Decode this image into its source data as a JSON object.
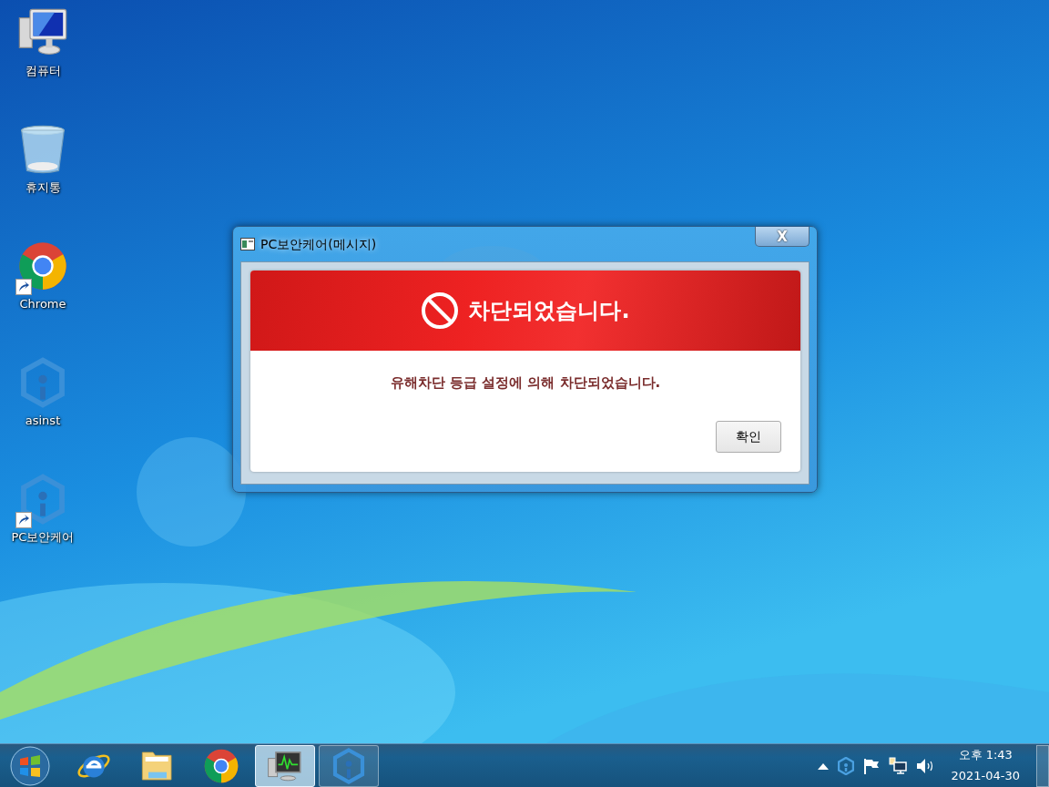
{
  "desktop_icons": [
    {
      "kind": "computer",
      "label": "컴퓨터",
      "shortcut": false
    },
    {
      "kind": "recycle",
      "label": "휴지통",
      "shortcut": false
    },
    {
      "kind": "chrome",
      "label": "Chrome",
      "shortcut": true
    },
    {
      "kind": "hexagon",
      "label": "asinst",
      "shortcut": false
    },
    {
      "kind": "hexagon",
      "label": "PC보안케어",
      "shortcut": true
    }
  ],
  "dialog": {
    "title": "PC보안케어(메시지)",
    "close": "X",
    "banner": "차단되었습니다.",
    "message": "유해차단 등급 설정에 의해 차단되었습니다.",
    "button": "확인"
  },
  "taskbar": {
    "pinned": [
      {
        "kind": "ie",
        "running": false,
        "selected": false
      },
      {
        "kind": "folder",
        "running": false,
        "selected": false
      },
      {
        "kind": "chrome",
        "running": false,
        "selected": false
      },
      {
        "kind": "monitor",
        "running": true,
        "selected": true
      },
      {
        "kind": "hexagon",
        "running": true,
        "selected": false
      }
    ],
    "tray": {
      "time": "오후 1:43",
      "date": "2021-04-30"
    }
  }
}
